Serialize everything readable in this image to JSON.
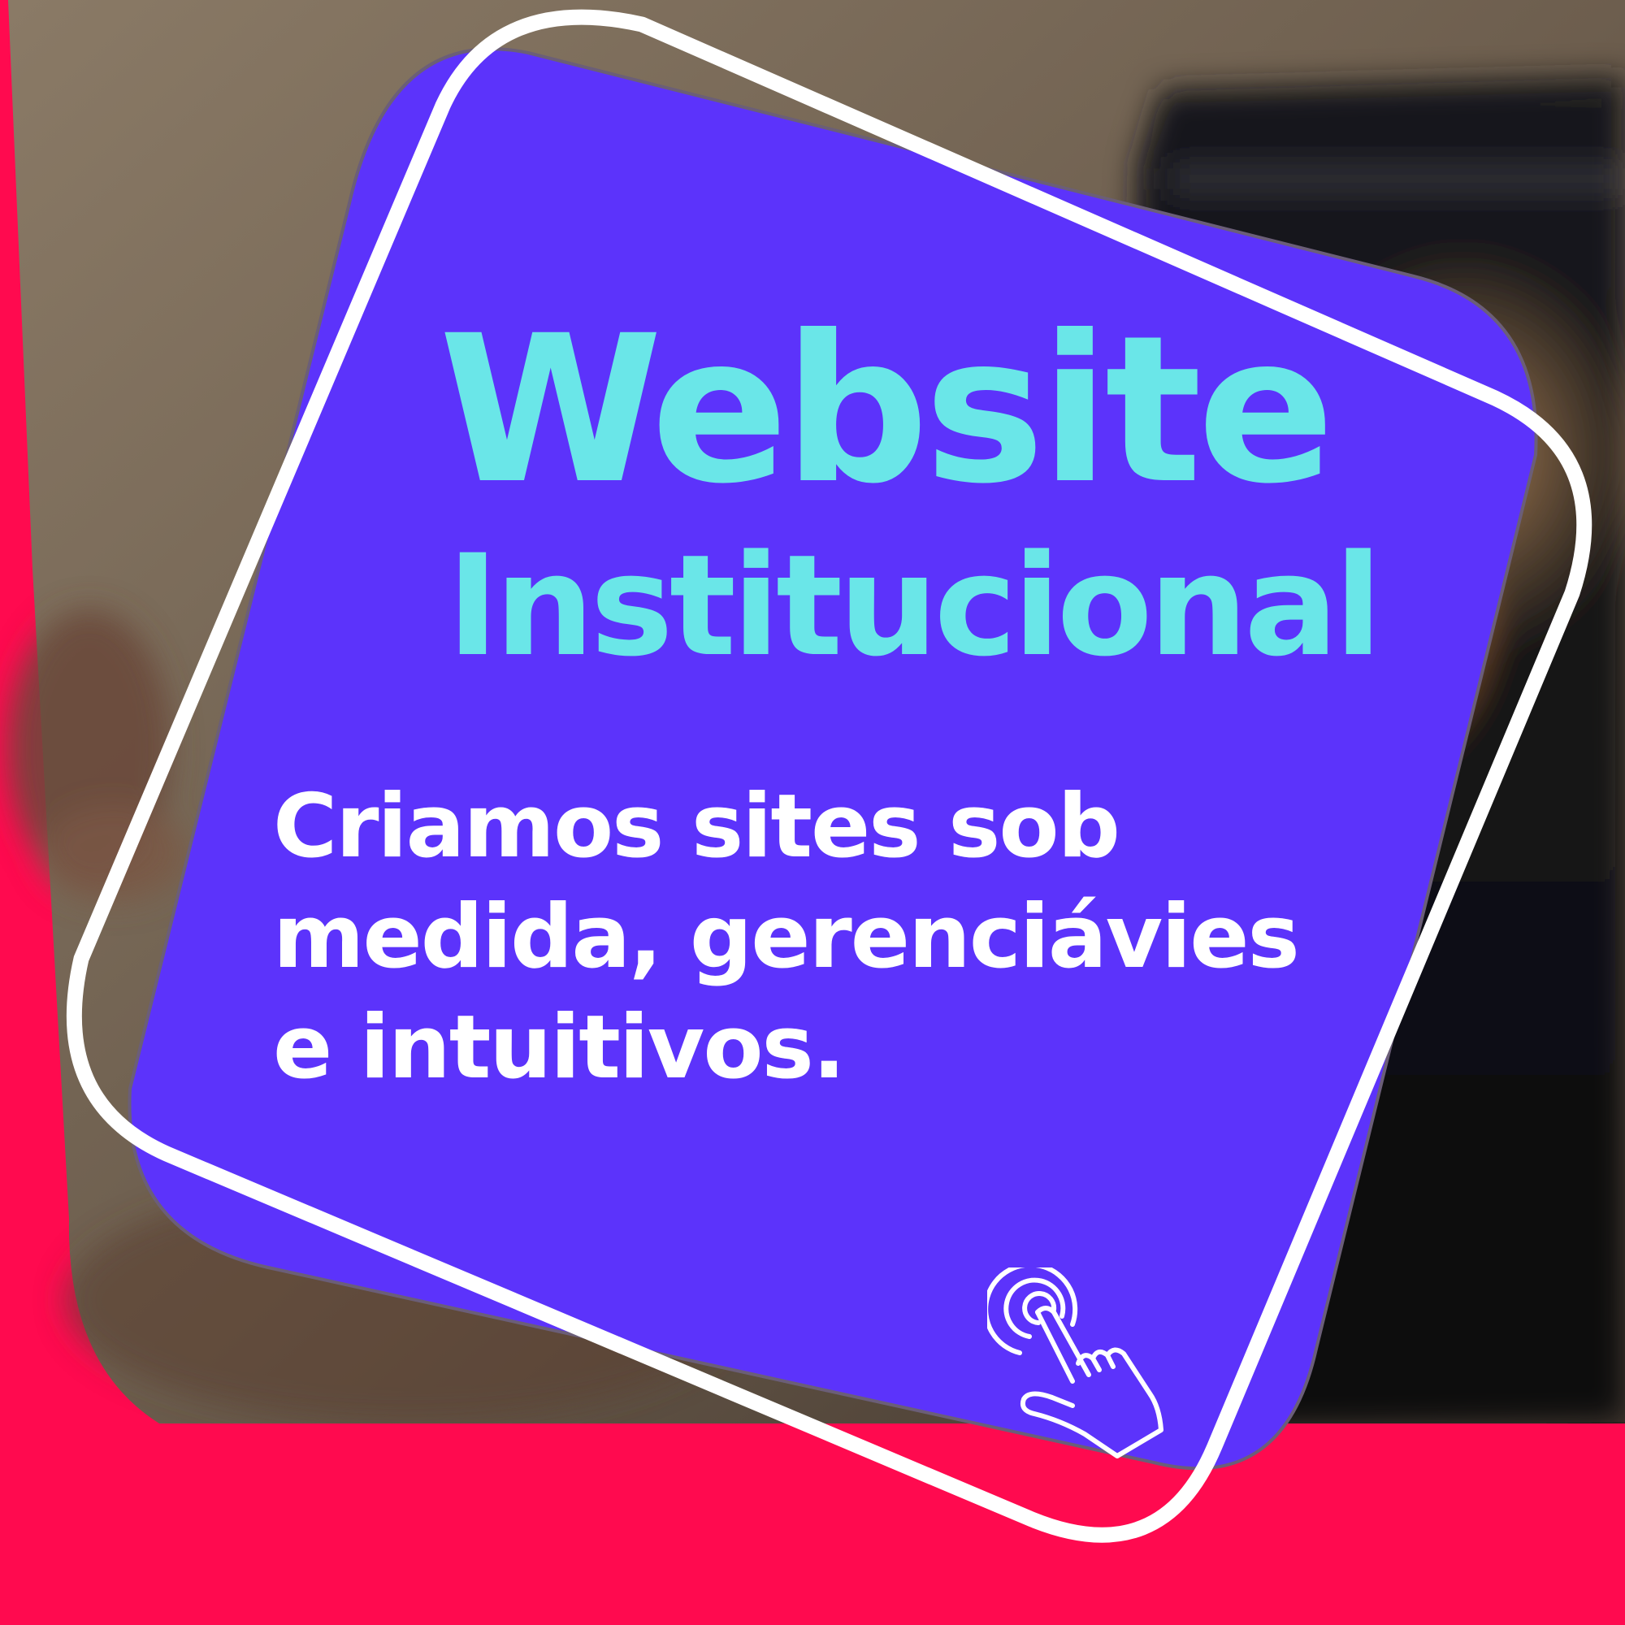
{
  "background": {
    "accent_color": "#ff0a4f",
    "photo_description_icon": "laptop-photo"
  },
  "card": {
    "fill_color": "#5c33fb",
    "outline_color": "#ffffff"
  },
  "headline": {
    "title": "Website",
    "subtitle": "Institucional",
    "title_color": "#6ae6e8"
  },
  "body": {
    "line1": "Criamos sites sob",
    "line2": "medida, gerenciávies",
    "line3": "e intuitivos.",
    "text_color": "#ffffff"
  },
  "icons": {
    "tap": "hand-tap-icon"
  }
}
